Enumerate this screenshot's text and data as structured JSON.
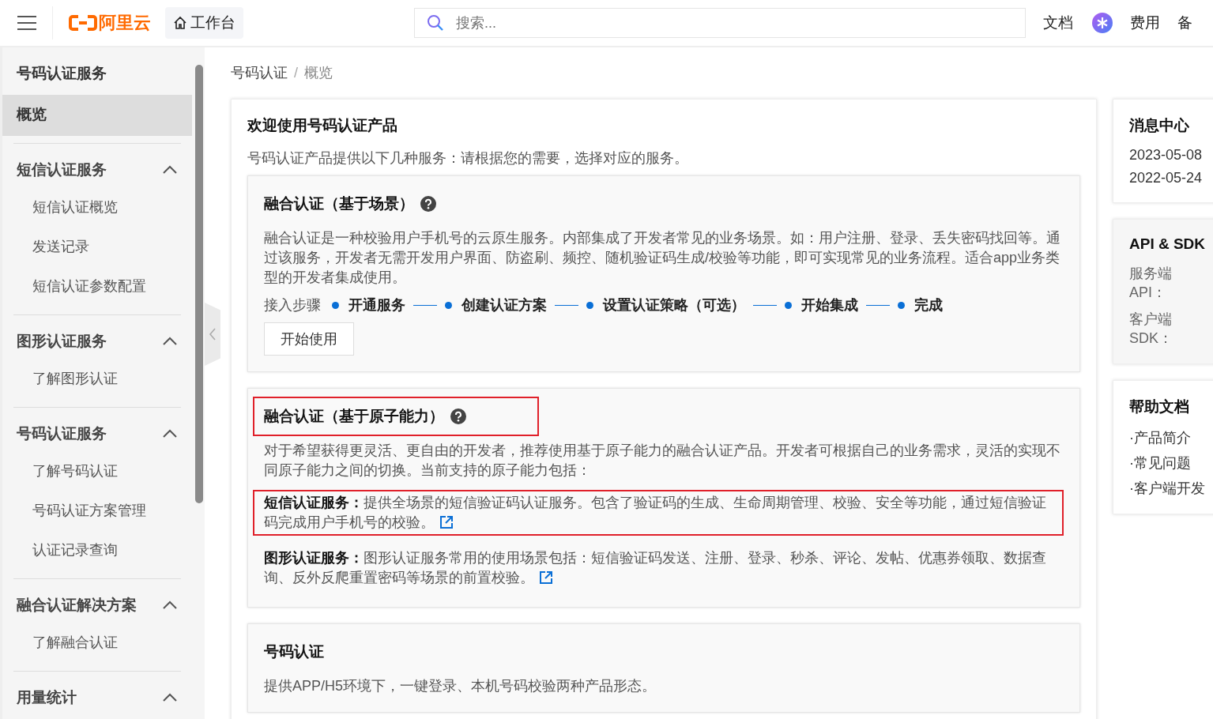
{
  "topbar": {
    "logo": "阿里云",
    "workbench": "工作台",
    "search": {
      "placeholder": "搜索..."
    },
    "links": [
      {
        "kind": "text",
        "label": "文档"
      },
      {
        "kind": "avatar"
      },
      {
        "kind": "text",
        "label": "费用"
      },
      {
        "kind": "text",
        "label": "备"
      }
    ]
  },
  "sidebar": {
    "title": "号码认证服务",
    "items": [
      {
        "label": "概览",
        "selected": true
      }
    ],
    "groups": [
      {
        "label": "短信认证服务",
        "expanded": true,
        "children": [
          {
            "label": "短信认证概览",
            "selected": false
          },
          {
            "label": "发送记录",
            "selected": false
          },
          {
            "label": "短信认证参数配置",
            "selected": false
          }
        ]
      },
      {
        "label": "图形认证服务",
        "expanded": true,
        "children": [
          {
            "label": "了解图形认证",
            "selected": false
          }
        ]
      },
      {
        "label": "号码认证服务",
        "expanded": true,
        "children": [
          {
            "label": "了解号码认证",
            "selected": false
          },
          {
            "label": "号码认证方案管理",
            "selected": false
          },
          {
            "label": "认证记录查询",
            "selected": false
          }
        ]
      },
      {
        "label": "融合认证解决方案",
        "expanded": true,
        "children": [
          {
            "label": "了解融合认证",
            "selected": false
          }
        ]
      },
      {
        "label": "用量统计",
        "expanded": true
      }
    ]
  },
  "breadcrumb": {
    "separator": "/",
    "items": [
      "号码认证",
      "概览"
    ]
  },
  "main": {
    "title": "欢迎使用号码认证产品",
    "intro": "号码认证产品提供以下几种服务：请根据您的需要，选择对应的服务。",
    "sections": [
      {
        "title": "融合认证（基于场景）",
        "highlighted": false,
        "description": "融合认证是一种校验用户手机号的云原生服务。内部集成了开发者常见的业务场景。如：用户注册、登录、丢失密码找回等。通过该服务，开发者无需开发用户界面、防盗刷、频控、随机验证码生成/校验等功能，即可实现常见的业务流程。适合app业务类型的开发者集成使用。",
        "steps_label": "接入步骤",
        "steps": [
          "开通服务",
          "创建认证方案",
          "设置认证策略（可选）",
          "开始集成",
          "完成"
        ],
        "button": "开始使用"
      },
      {
        "title": "融合认证（基于原子能力）",
        "highlighted": true,
        "description": "对于希望获得更灵活、更自由的开发者，推荐使用基于原子能力的融合认证产品。开发者可根据自己的业务需求，灵活的实现不同原子能力之间的切换。当前支持的原子能力包括：",
        "items": [
          {
            "text": "**短信认证服务：**提供全场景的短信验证码认证服务。包含了验证码的生成、生命周期管理、校验、安全等功能，通过短信验证码完成用户手机号的校验。",
            "highlighted": true
          },
          {
            "text": "**图形认证服务：**图形认证服务常用的使用场景包括：短信验证码发送、注册、登录、秒杀、评论、发帖、优惠券领取、数据查询、反外反爬重置密码等场景的前置校验。",
            "highlighted": false
          }
        ]
      },
      {
        "title": "号码认证",
        "highlighted": false,
        "description": "提供APP/H5环境下，一键登录、本机号码校验两种产品形态。"
      }
    ]
  },
  "right": {
    "messages": {
      "title": "消息中心",
      "items": [
        "2023-05-08",
        "2022-05-24"
      ]
    },
    "api": {
      "title": "API & SDK",
      "rows": [
        "服务端API：",
        "客户端SDK："
      ]
    },
    "help": {
      "title": "帮助文档",
      "items": [
        "·产品简介",
        "·常见问题",
        "·客户端开发"
      ]
    }
  }
}
